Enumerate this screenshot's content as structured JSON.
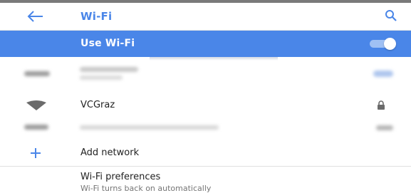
{
  "header": {
    "title": "Wi-Fi",
    "back_icon": "arrow-left-icon",
    "search_icon": "search-icon"
  },
  "master_switch": {
    "label": "Use Wi-Fi",
    "state": "on"
  },
  "networks": [
    {
      "name": "",
      "obscured": true,
      "icon": "wifi-signal-icon"
    },
    {
      "name": "VCGraz",
      "obscured": false,
      "icon": "wifi-signal-icon",
      "secured_icon": "lock-icon"
    },
    {
      "name": "",
      "obscured": true,
      "icon": "wifi-signal-icon"
    }
  ],
  "add_network": {
    "label": "Add network",
    "icon": "plus-icon"
  },
  "preferences": {
    "title": "Wi-Fi preferences",
    "subtitle": "Wi-Fi turns back on automatically"
  },
  "colors": {
    "accent": "#4a86e8",
    "text": "#222222",
    "secondary_text": "#757575"
  }
}
